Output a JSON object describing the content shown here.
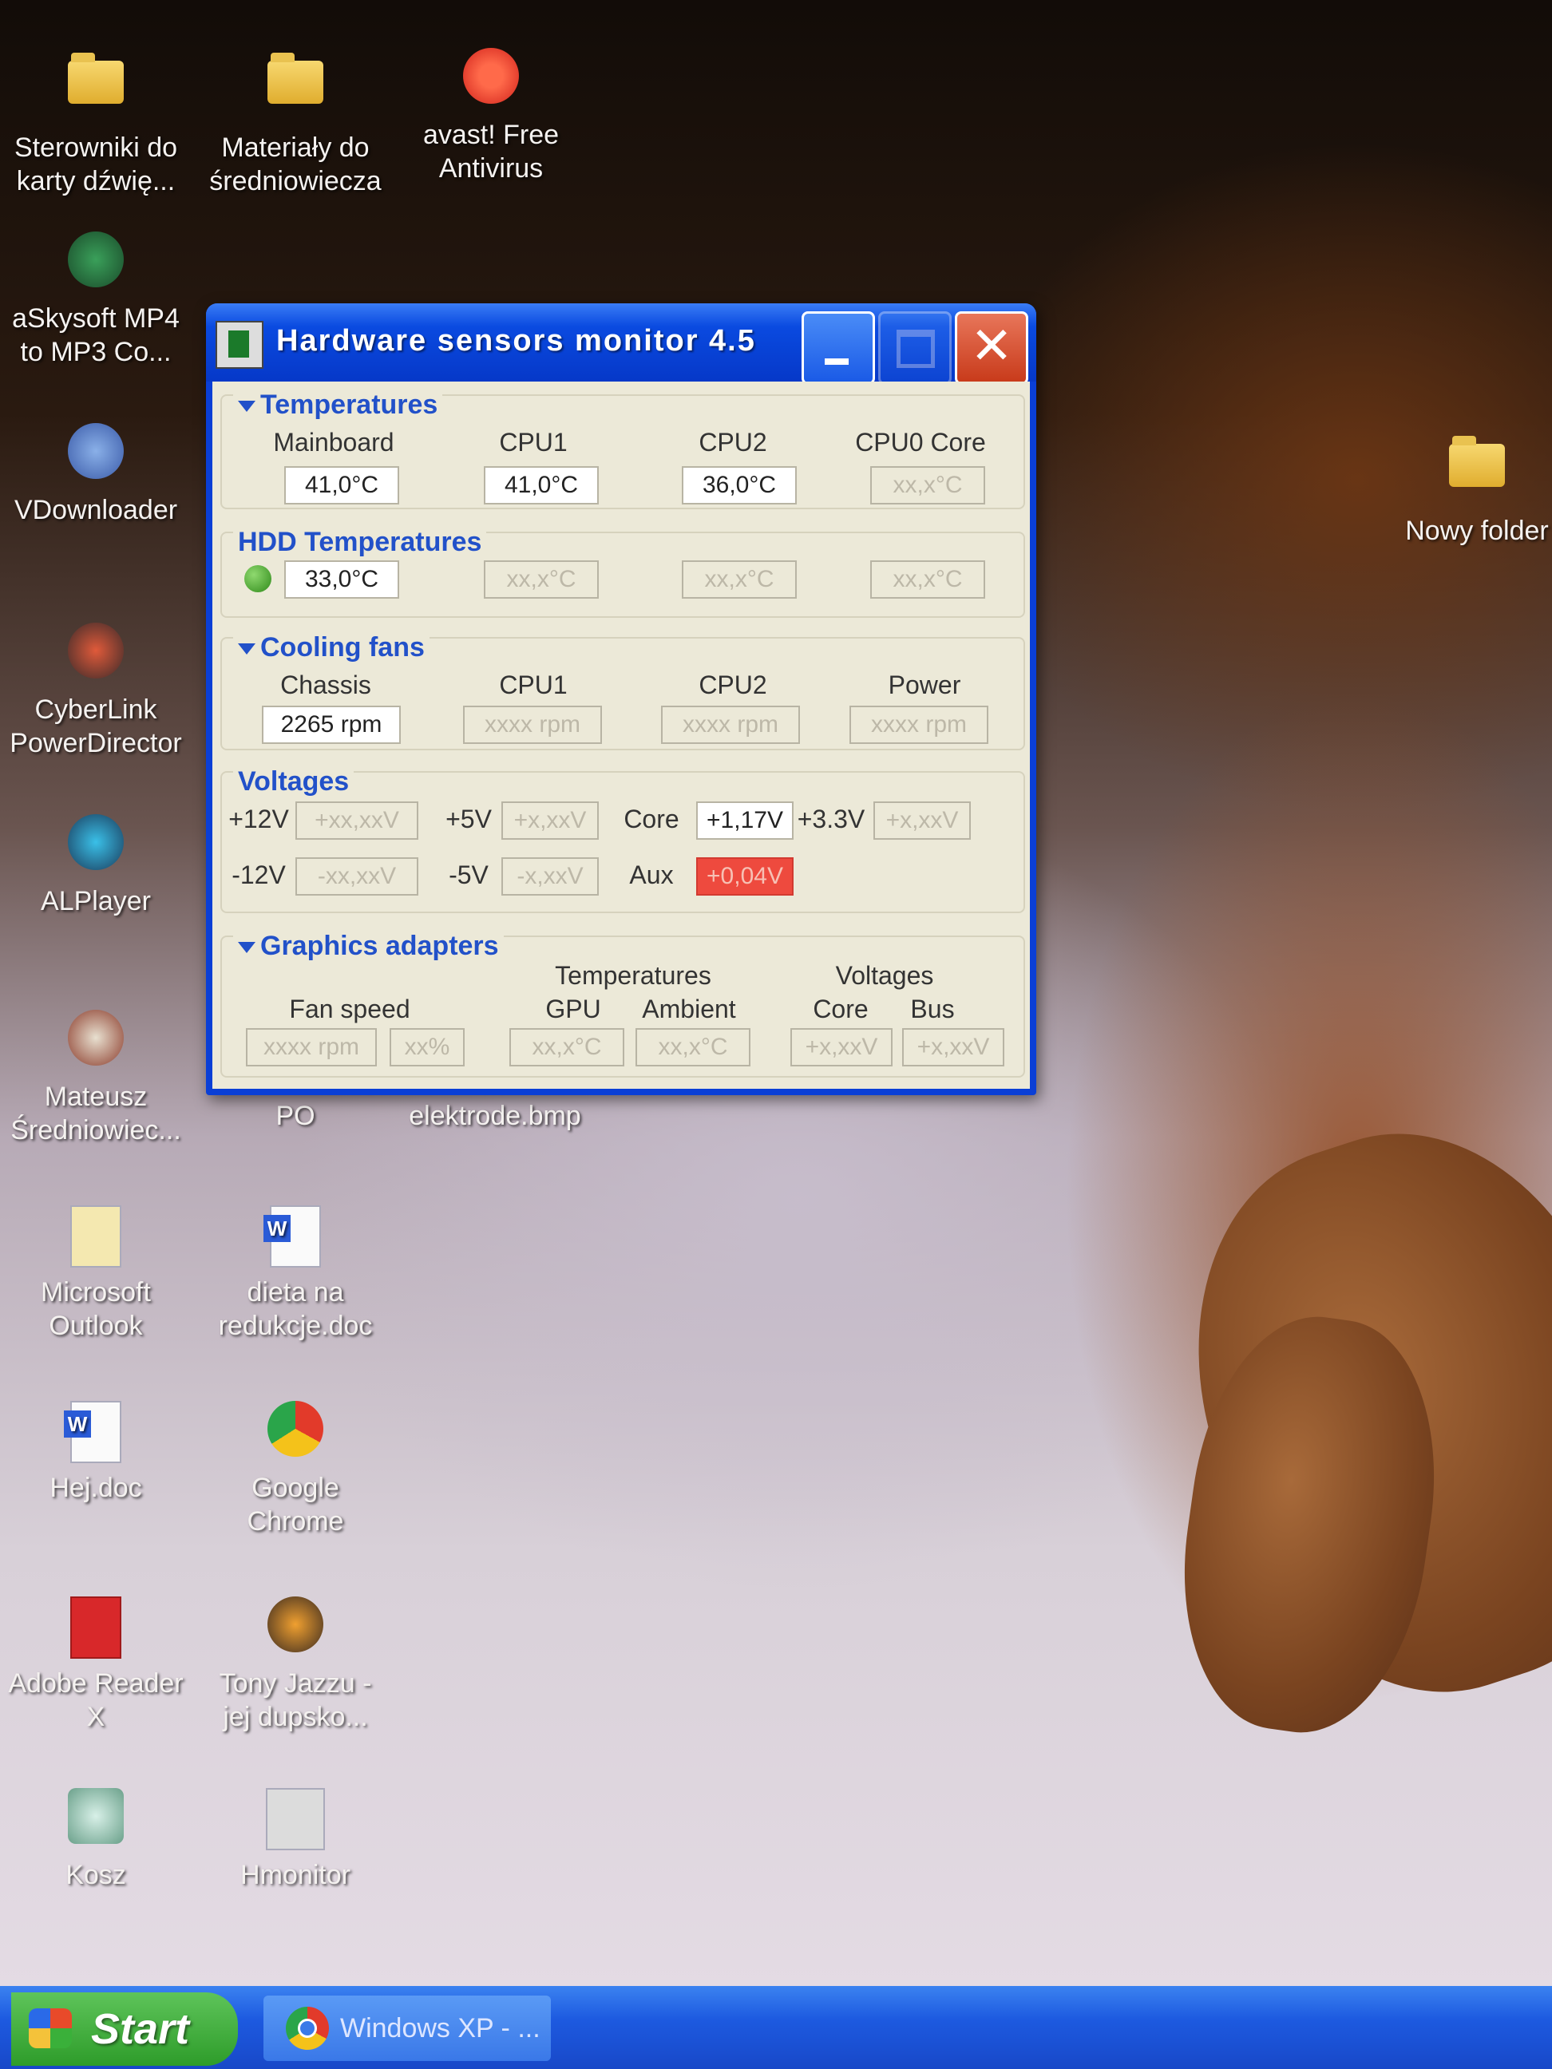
{
  "desktop": {
    "icons": [
      {
        "label": "Sterowniki do karty dźwię...",
        "icon": "folder-icon"
      },
      {
        "label": "Materiały do średniowiecza",
        "icon": "folder-icon"
      },
      {
        "label": "avast! Free Antivirus",
        "icon": "avast-icon"
      },
      {
        "label": "aSkysoft MP4 to MP3 Co...",
        "icon": "converter-icon"
      },
      {
        "label": "VDownloader",
        "icon": "vdownloader-icon"
      },
      {
        "label": "CyberLink PowerDirector",
        "icon": "powerdirector-icon"
      },
      {
        "label": "ALPlayer",
        "icon": "alplayer-icon"
      },
      {
        "label": "Mateusz Średniowiec...",
        "icon": "document-icon"
      },
      {
        "label": "Ćwiczenia do PO",
        "icon": "word-doc-icon"
      },
      {
        "label": "na elektrode.bmp",
        "icon": "bitmap-icon"
      },
      {
        "label": "Microsoft Outlook",
        "icon": "outlook-icon"
      },
      {
        "label": "dieta na redukcje.doc",
        "icon": "word-doc-icon"
      },
      {
        "label": "Hej.doc",
        "icon": "word-doc-icon"
      },
      {
        "label": "Google Chrome",
        "icon": "chrome-icon"
      },
      {
        "label": "Adobe Reader X",
        "icon": "adobe-reader-icon"
      },
      {
        "label": "Tony Jazzu - jej dupsko...",
        "icon": "mp4-icon"
      },
      {
        "label": "Kosz",
        "icon": "recycle-bin-icon"
      },
      {
        "label": "Hmonitor",
        "icon": "hmonitor-icon"
      },
      {
        "label": "Nowy folder",
        "icon": "folder-icon"
      }
    ]
  },
  "window": {
    "title": "Hardware sensors monitor 4.5",
    "temperatures": {
      "header": "Temperatures",
      "labels": [
        "Mainboard",
        "CPU1",
        "CPU2",
        "CPU0 Core"
      ],
      "values": [
        "41,0°C",
        "41,0°C",
        "36,0°C",
        "xx,x°C"
      ]
    },
    "hdd": {
      "header": "HDD Temperatures",
      "values": [
        "33,0°C",
        "xx,x°C",
        "xx,x°C",
        "xx,x°C"
      ]
    },
    "fans": {
      "header": "Cooling fans",
      "labels": [
        "Chassis",
        "CPU1",
        "CPU2",
        "Power"
      ],
      "values": [
        "2265 rpm",
        "xxxx rpm",
        "xxxx rpm",
        "xxxx rpm"
      ]
    },
    "voltages": {
      "header": "Voltages",
      "p12_label": "+12V",
      "p12_value": "+xx,xxV",
      "p5_label": "+5V",
      "p5_value": "+x,xxV",
      "core_label": "Core",
      "core_value": "+1,17V",
      "p33_label": "+3.3V",
      "p33_value": "+x,xxV",
      "m12_label": "-12V",
      "m12_value": "-xx,xxV",
      "m5_label": "-5V",
      "m5_value": "-x,xxV",
      "aux_label": "Aux",
      "aux_value": "+0,04V"
    },
    "graphics": {
      "header": "Graphics adapters",
      "fan_speed_label": "Fan speed",
      "temperatures_label": "Temperatures",
      "voltages_label": "Voltages",
      "gpu_label": "GPU",
      "ambient_label": "Ambient",
      "core_label": "Core",
      "bus_label": "Bus",
      "fan_rpm": "xxxx rpm",
      "fan_pct": "xx%",
      "gpu_temp": "xx,x°C",
      "ambient_temp": "xx,x°C",
      "core_v": "+x,xxV",
      "bus_v": "+x,xxV"
    }
  },
  "taskbar": {
    "start_label": "Start",
    "task_label": "Windows XP - ..."
  },
  "colors": {
    "alarm": "#ee4a3e",
    "group_header": "#2251c9",
    "titlebar": "#0a4ae0"
  }
}
